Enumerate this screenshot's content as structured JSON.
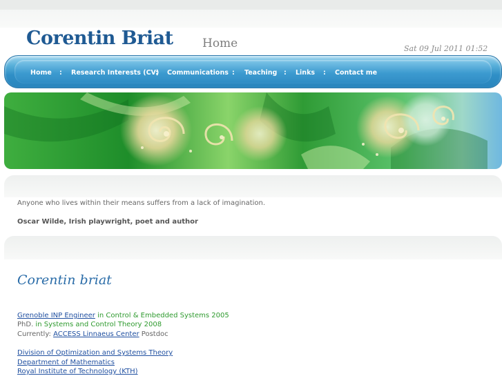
{
  "header": {
    "site_title": "Corentin Briat",
    "page_title": "Home",
    "datetime": "Sat 09 Jul 2011 01:52"
  },
  "nav": {
    "separator": ":",
    "items": [
      {
        "label": "Home"
      },
      {
        "label": "Research Interests (CV)"
      },
      {
        "label": "Communications"
      },
      {
        "label": "Teaching"
      },
      {
        "label": "Links"
      },
      {
        "label": "Contact me"
      }
    ]
  },
  "quote": {
    "text": "Anyone who lives within their means suffers from a lack of imagination.",
    "author": "Oscar Wilde, Irish playwright, poet and author"
  },
  "content": {
    "heading": "Corentin briat",
    "line1": {
      "link": "Grenoble INP Engineer",
      "rest": " in Control & Embedded Systems 2005"
    },
    "line2": {
      "prefix": "PhD.",
      "rest": " in Systems and Control Theory 2008"
    },
    "line3": {
      "prefix": "Currently: ",
      "link": "ACCESS Linnaeus Center",
      "suffix": " Postdoc"
    },
    "affiliations": [
      "Division of Optimization and Systems Theory",
      "Department of Mathematics",
      "Royal Institute of Technology (KTH)"
    ]
  },
  "colors": {
    "title_blue": "#1f5a93",
    "nav_blue": "#2f8fc6",
    "link_blue": "#1f4fa0",
    "text_green": "#2e9a2e"
  }
}
